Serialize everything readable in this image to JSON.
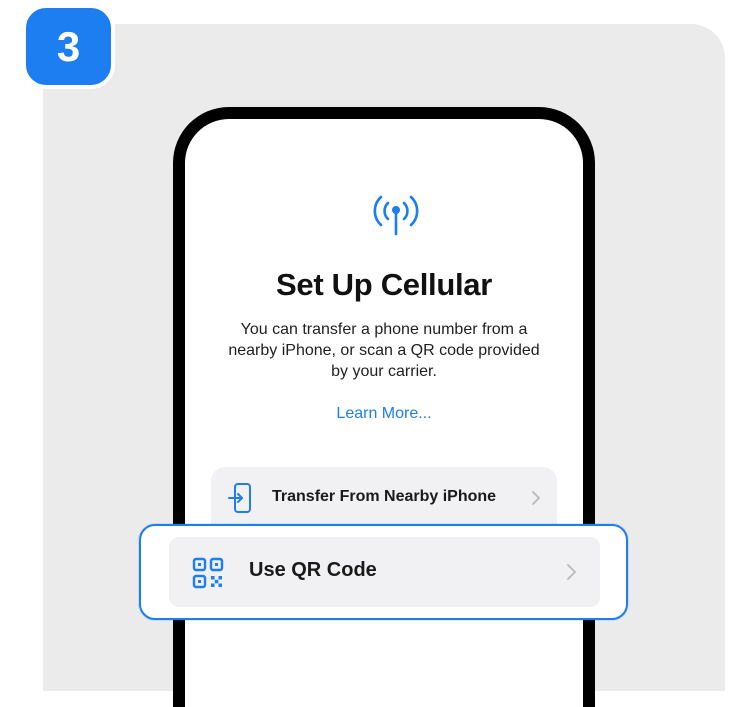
{
  "step": {
    "number": "3"
  },
  "screen": {
    "title": "Set Up Cellular",
    "subtitle": "You can transfer a phone number from a\nnearby iPhone, or scan a QR code provided\nby your carrier.",
    "learn_more": "Learn More..."
  },
  "options": {
    "transfer": {
      "label": "Transfer From Nearby iPhone",
      "icon": "transfer-into-phone-icon"
    },
    "qr": {
      "label": "Use QR Code",
      "icon": "qr-code-icon"
    }
  },
  "colors": {
    "accent": "#1c7ef0",
    "card_background": "#ebebec",
    "row_background": "#f1f1f3"
  }
}
